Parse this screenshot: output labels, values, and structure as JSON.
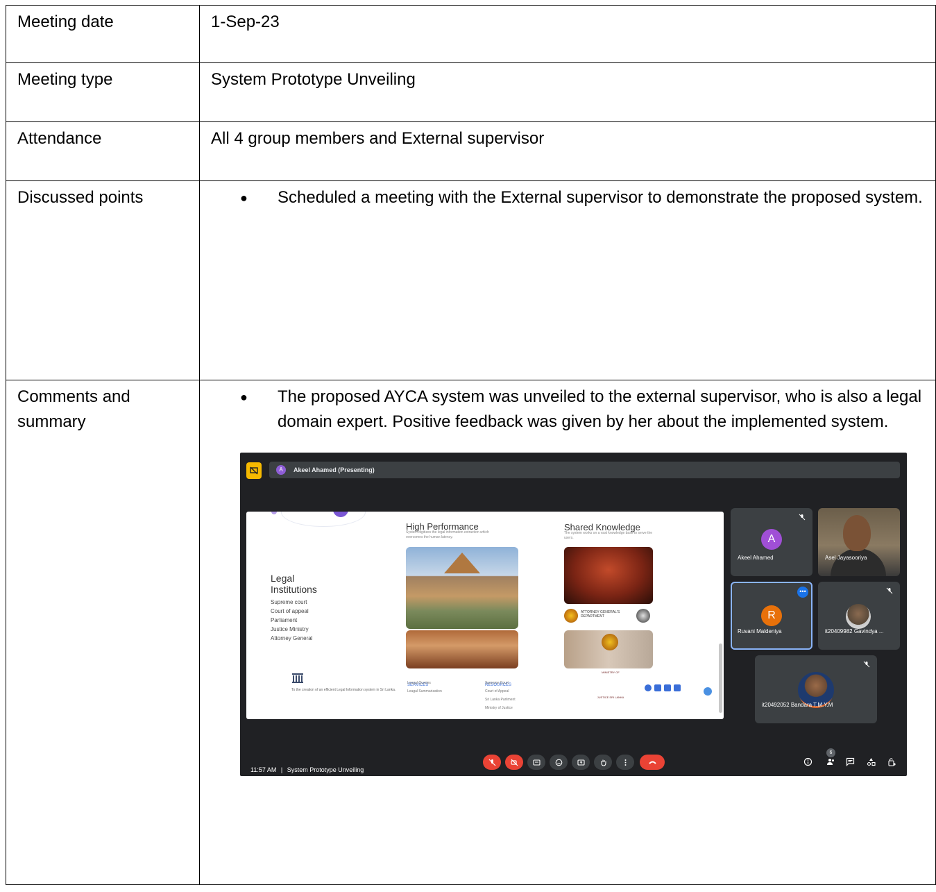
{
  "rows": {
    "meeting_date": {
      "label": "Meeting date",
      "value": "1-Sep-23"
    },
    "meeting_type": {
      "label": "Meeting type",
      "value": "System Prototype Unveiling"
    },
    "attendance": {
      "label": "Attendance",
      "value": "All 4 group members and External supervisor"
    },
    "discussed_points": {
      "label": "Discussed points",
      "bullets": [
        "Scheduled a meeting with the External supervisor to demonstrate the proposed system."
      ]
    },
    "comments": {
      "label": "Comments and summary",
      "bullets": [
        "The proposed AYCA system was unveiled to the external supervisor, who is also a legal domain expert. Positive feedback was given by her about the implemented system."
      ]
    }
  },
  "meet": {
    "presenter": {
      "initial": "A",
      "label": "Akeel Ahamed (Presenting)"
    },
    "slide": {
      "legal_title": "Legal Institutions",
      "legal_items": [
        "Supreme court",
        "Court of appeal",
        "Parliament",
        "Justice Ministry",
        "Attorney General"
      ],
      "col1_title": "High Performance",
      "col1_desc": "System digitizes the legal information extraction which overcomes the human latency.",
      "col2_title": "Shared Knowledge",
      "col2_desc": "The system works on a vast knowledge base to serve the users.",
      "ago_text": "ATTORNEY GENERAL'S DEPARTMENT",
      "moj_text": "MINISTRY OF JUSTICE SRI LANKA",
      "footer_text": "To the creation of an efficient Legal Information system in Sri Lanka.",
      "services_head": "SERVICES",
      "services": [
        "Leagal Queries",
        "Leagal Summarization"
      ],
      "resources_head": "RESOURCES",
      "resources": [
        "Supreme Court",
        "Court of Appeal",
        "Sri Lanka Parliment",
        "Ministry of Justice"
      ]
    },
    "participants": {
      "akeel": {
        "initial": "A",
        "name": "Akeel Ahamed",
        "color": "#a04fd6"
      },
      "asel": {
        "name": "Asel Jayasooriya"
      },
      "ruvani": {
        "initial": "R",
        "name": "Ruvani Maldeniya",
        "color": "#e8710a"
      },
      "gavindya": {
        "name": "it20409982 Gavindya ..."
      },
      "bandara": {
        "name": "it20492052 Bandara T.M.Y.M"
      }
    },
    "bottom": {
      "time": "11:57 AM",
      "separator": "|",
      "meeting_name": "System Prototype Unveiling",
      "people_count": "6"
    },
    "icons": [
      "present-icon",
      "mic-off-icon",
      "camera-off-icon",
      "captions-icon",
      "emoji-icon",
      "present-screen-icon",
      "raise-hand-icon",
      "more-icon",
      "end-call-icon",
      "info-icon",
      "people-icon",
      "chat-icon",
      "activities-icon",
      "host-controls-icon"
    ]
  }
}
